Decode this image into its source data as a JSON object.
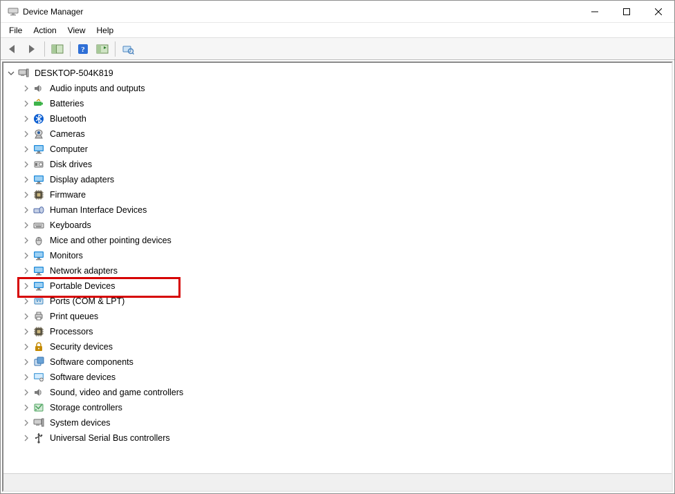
{
  "title": "Device Manager",
  "menus": {
    "file": "File",
    "action": "Action",
    "view": "View",
    "help": "Help"
  },
  "toolbar": {
    "back": "Back",
    "forward": "Forward",
    "show_hide": "Show/hide console tree",
    "help": "Help",
    "action_new": "Action",
    "scan": "Scan for hardware changes"
  },
  "root": "DESKTOP-504K819",
  "categories": [
    {
      "id": "audio",
      "label": "Audio inputs and outputs",
      "icon": "speaker"
    },
    {
      "id": "batteries",
      "label": "Batteries",
      "icon": "battery"
    },
    {
      "id": "bluetooth",
      "label": "Bluetooth",
      "icon": "bluetooth"
    },
    {
      "id": "cameras",
      "label": "Cameras",
      "icon": "camera"
    },
    {
      "id": "computer",
      "label": "Computer",
      "icon": "monitor"
    },
    {
      "id": "disk",
      "label": "Disk drives",
      "icon": "hdd"
    },
    {
      "id": "display",
      "label": "Display adapters",
      "icon": "monitor"
    },
    {
      "id": "firmware",
      "label": "Firmware",
      "icon": "chip"
    },
    {
      "id": "hid",
      "label": "Human Interface Devices",
      "icon": "hid"
    },
    {
      "id": "keyboards",
      "label": "Keyboards",
      "icon": "keyboard"
    },
    {
      "id": "mice",
      "label": "Mice and other pointing devices",
      "icon": "mouse"
    },
    {
      "id": "monitors",
      "label": "Monitors",
      "icon": "monitor"
    },
    {
      "id": "network",
      "label": "Network adapters",
      "icon": "monitor"
    },
    {
      "id": "portable",
      "label": "Portable Devices",
      "icon": "monitor",
      "highlight": true
    },
    {
      "id": "ports",
      "label": "Ports (COM & LPT)",
      "icon": "port"
    },
    {
      "id": "printq",
      "label": "Print queues",
      "icon": "printer"
    },
    {
      "id": "processors",
      "label": "Processors",
      "icon": "chip"
    },
    {
      "id": "security",
      "label": "Security devices",
      "icon": "lock"
    },
    {
      "id": "swcomp",
      "label": "Software components",
      "icon": "component"
    },
    {
      "id": "swdev",
      "label": "Software devices",
      "icon": "swdev"
    },
    {
      "id": "sound",
      "label": "Sound, video and game controllers",
      "icon": "speaker"
    },
    {
      "id": "storage",
      "label": "Storage controllers",
      "icon": "storage"
    },
    {
      "id": "system",
      "label": "System devices",
      "icon": "computer"
    },
    {
      "id": "usb",
      "label": "Universal Serial Bus controllers",
      "icon": "usb"
    }
  ],
  "icon_colors": {
    "speaker": "#7b7b7b",
    "battery": "#3eb34a",
    "bluetooth": "#0a5dd1",
    "camera": "#6d6d6d",
    "monitor": "#1887d8",
    "hdd": "#777",
    "chip": "#7a715b",
    "hid": "#4f69a8",
    "keyboard": "#6b6b6b",
    "mouse": "#6e6e6e",
    "port": "#3a86c2",
    "printer": "#6c6c6c",
    "lock": "#c48a00",
    "component": "#3874b1",
    "swdev": "#4fa0d8",
    "storage": "#49a35c",
    "computer": "#6d6d6d",
    "usb": "#4a4a4a"
  }
}
